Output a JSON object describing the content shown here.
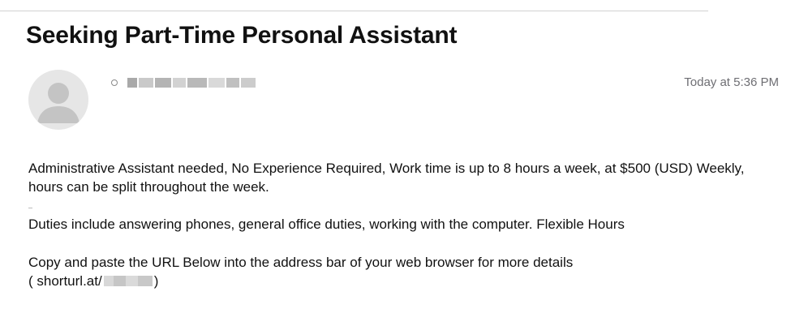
{
  "email": {
    "subject": "Seeking Part-Time Personal Assistant",
    "timestamp": "Today at 5:36 PM",
    "body": {
      "paragraph_1": "Administrative Assistant needed, No Experience Required, Work time is up to 8 hours a week, at $500 (USD) Weekly, hours can be split throughout the week.",
      "paragraph_2": "Duties include answering phones, general office duties, working with the computer. Flexible Hours",
      "paragraph_3": "Copy and paste the URL Below into the address bar of your web browser for more details",
      "url_prefix": "( shorturl.at/",
      "url_suffix": ")"
    }
  },
  "icons": {
    "avatar": "person-silhouette-icon",
    "status": "status-dot-icon"
  },
  "colors": {
    "timestamp": "#6e6e73",
    "avatar_bg": "#e6e6e6",
    "avatar_fg": "#c4c4c4"
  }
}
